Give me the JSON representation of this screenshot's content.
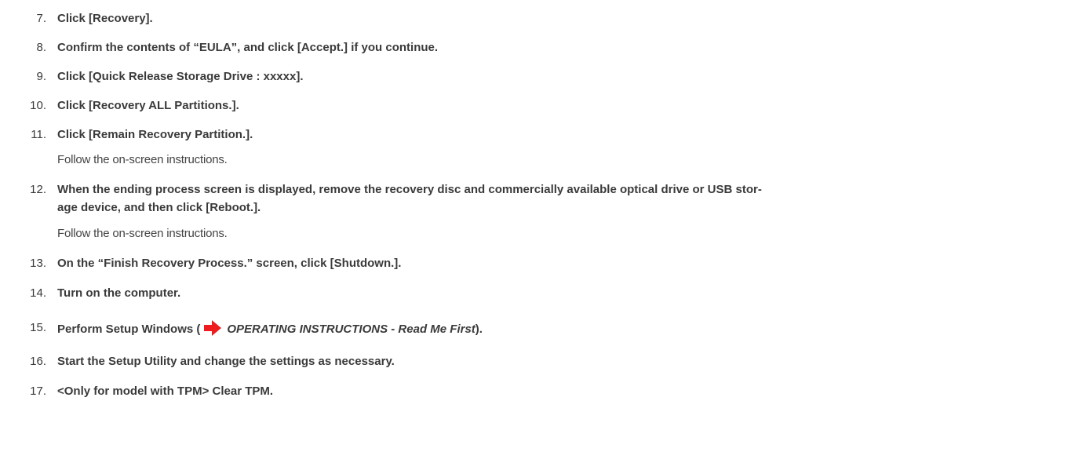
{
  "steps": [
    {
      "number": "7.",
      "text": "Click [Recovery]."
    },
    {
      "number": "8.",
      "text": "Confirm the contents of “EULA”, and click [Accept.] if you continue."
    },
    {
      "number": "9.",
      "text": "Click [Quick Release Storage Drive : xxxxx]."
    },
    {
      "number": "10.",
      "text": "Click [Recovery ALL Partitions.]."
    },
    {
      "number": "11.",
      "text": "Click [Remain Recovery Partition.].",
      "note": "Follow the on-screen instructions."
    },
    {
      "number": "12.",
      "text_line1": "When the ending process screen is displayed, remove the recovery disc and commercially available optical drive or USB stor-",
      "text_line2": "age device, and then click [Reboot.].",
      "note": "Follow the on-screen instructions."
    },
    {
      "number": "13.",
      "text": "On the “Finish Recovery Process.” screen, click [Shutdown.]."
    },
    {
      "number": "14.",
      "text": "Turn on the computer."
    },
    {
      "number": "15.",
      "text_before": "Perform Setup Windows (",
      "reference": "OPERATING INSTRUCTIONS - Read Me First",
      "text_after": ")."
    },
    {
      "number": "16.",
      "text": "Start the Setup Utility and change the settings as necessary."
    },
    {
      "number": "17.",
      "text": "<Only for model with TPM> Clear TPM."
    }
  ],
  "icons": {
    "reference_arrow": "red-arrow-icon",
    "reference_arrow_color": "#ee1c1c"
  }
}
